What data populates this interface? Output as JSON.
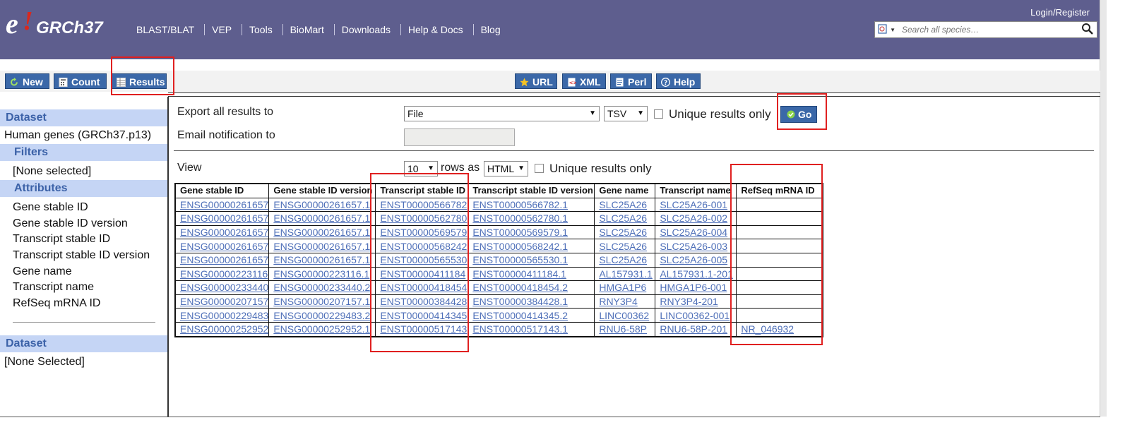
{
  "header": {
    "logo_e": "e",
    "logo_name": "GRCh37",
    "nav": [
      "BLAST/BLAT",
      "VEP",
      "Tools",
      "BioMart",
      "Downloads",
      "Help & Docs",
      "Blog"
    ],
    "login": "Login/Register",
    "search_placeholder": "Search all species…"
  },
  "toolbar": {
    "new": "New",
    "count": "Count",
    "results": "Results",
    "url": "URL",
    "xml": "XML",
    "perl": "Perl",
    "help": "Help"
  },
  "sidebar": {
    "dataset_heading": "Dataset",
    "dataset_value": "Human genes (GRCh37.p13)",
    "filters_heading": "Filters",
    "filters_value": "[None selected]",
    "attributes_heading": "Attributes",
    "attributes": [
      "Gene stable ID",
      "Gene stable ID version",
      "Transcript stable ID",
      "Transcript stable ID version",
      "Gene name",
      "Transcript name",
      "RefSeq mRNA ID"
    ],
    "dataset2_heading": "Dataset",
    "dataset2_value": "[None Selected]"
  },
  "export": {
    "label": "Export  all results to",
    "destination": "File",
    "format": "TSV",
    "unique_label": "Unique results only",
    "go": "Go",
    "email_label": "Email notification to"
  },
  "view": {
    "label": "View",
    "rows": "10",
    "rows_as": "rows as",
    "format": "HTML",
    "unique_label": "Unique results only"
  },
  "table": {
    "headers": [
      "Gene stable ID",
      "Gene stable ID version",
      "Transcript stable ID",
      "Transcript stable ID version",
      "Gene name",
      "Transcript name",
      "RefSeq mRNA ID"
    ],
    "rows": [
      [
        "ENSG00000261657",
        "ENSG00000261657.1",
        "ENST00000566782",
        "ENST00000566782.1",
        "SLC25A26",
        "SLC25A26-001",
        ""
      ],
      [
        "ENSG00000261657",
        "ENSG00000261657.1",
        "ENST00000562780",
        "ENST00000562780.1",
        "SLC25A26",
        "SLC25A26-002",
        ""
      ],
      [
        "ENSG00000261657",
        "ENSG00000261657.1",
        "ENST00000569579",
        "ENST00000569579.1",
        "SLC25A26",
        "SLC25A26-004",
        ""
      ],
      [
        "ENSG00000261657",
        "ENSG00000261657.1",
        "ENST00000568242",
        "ENST00000568242.1",
        "SLC25A26",
        "SLC25A26-003",
        ""
      ],
      [
        "ENSG00000261657",
        "ENSG00000261657.1",
        "ENST00000565530",
        "ENST00000565530.1",
        "SLC25A26",
        "SLC25A26-005",
        ""
      ],
      [
        "ENSG00000223116",
        "ENSG00000223116.1",
        "ENST00000411184",
        "ENST00000411184.1",
        "AL157931.1",
        "AL157931.1-201",
        ""
      ],
      [
        "ENSG00000233440",
        "ENSG00000233440.2",
        "ENST00000418454",
        "ENST00000418454.2",
        "HMGA1P6",
        "HMGA1P6-001",
        ""
      ],
      [
        "ENSG00000207157",
        "ENSG00000207157.1",
        "ENST00000384428",
        "ENST00000384428.1",
        "RNY3P4",
        "RNY3P4-201",
        ""
      ],
      [
        "ENSG00000229483",
        "ENSG00000229483.2",
        "ENST00000414345",
        "ENST00000414345.2",
        "LINC00362",
        "LINC00362-001",
        ""
      ],
      [
        "ENSG00000252952",
        "ENSG00000252952.1",
        "ENST00000517143",
        "ENST00000517143.1",
        "RNU6-58P",
        "RNU6-58P-201",
        "NR_046932"
      ]
    ]
  },
  "colors": {
    "header_bg": "#5e5e8e",
    "button_blue": "#3b68a8",
    "sidebar_heading_bg": "#c5d5f5",
    "link_color": "#4e6fb8",
    "annotation_red": "#e02020"
  }
}
